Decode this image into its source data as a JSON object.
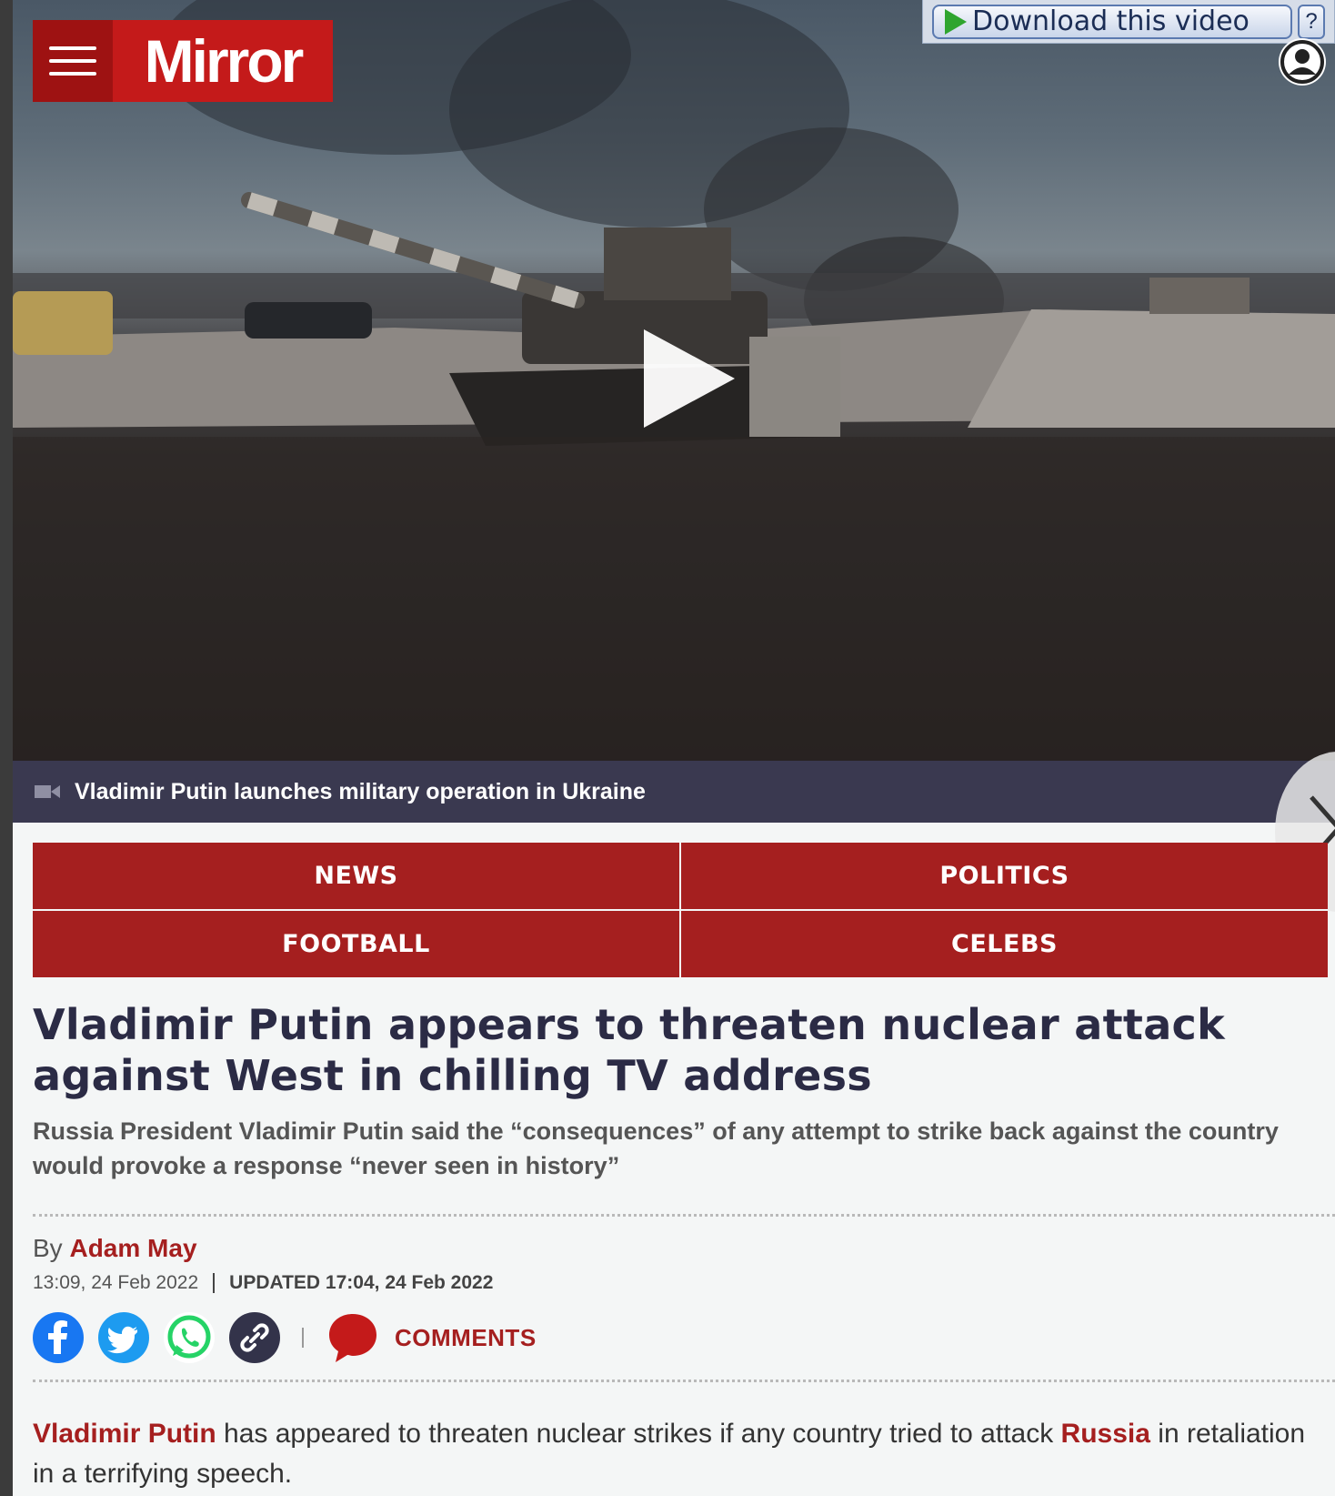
{
  "brand": {
    "name": "Mirror",
    "color": "#c41a1a",
    "nav_color": "#a51f1f"
  },
  "video": {
    "download_label": "Download this video",
    "help_label": "?",
    "caption": "Vladimir Putin launches military operation in Ukraine"
  },
  "nav": [
    {
      "label": "NEWS"
    },
    {
      "label": "POLITICS"
    },
    {
      "label": "FOOTBALL"
    },
    {
      "label": "CELEBS"
    }
  ],
  "article": {
    "headline": "Vladimir Putin appears to threaten nuclear attack against West in chilling TV address",
    "standfirst": "Russia President Vladimir Putin said the “consequences” of any attempt to strike back against the country would provoke a response “never seen in history”",
    "byline_prefix": "By",
    "author": "Adam May",
    "published": "13:09, 24 Feb 2022",
    "updated": "UPDATED 17:04, 24 Feb 2022",
    "comments_label": "COMMENTS",
    "body": {
      "link1": "Vladimir Putin",
      "text1": " has appeared to threaten nuclear strikes if any country tried to attack ",
      "link2": "Russia",
      "text2": " in retaliation in a terrifying speech."
    }
  },
  "share_icons": [
    "facebook-icon",
    "twitter-icon",
    "whatsapp-icon",
    "link-icon",
    "comment-bubble-icon"
  ]
}
